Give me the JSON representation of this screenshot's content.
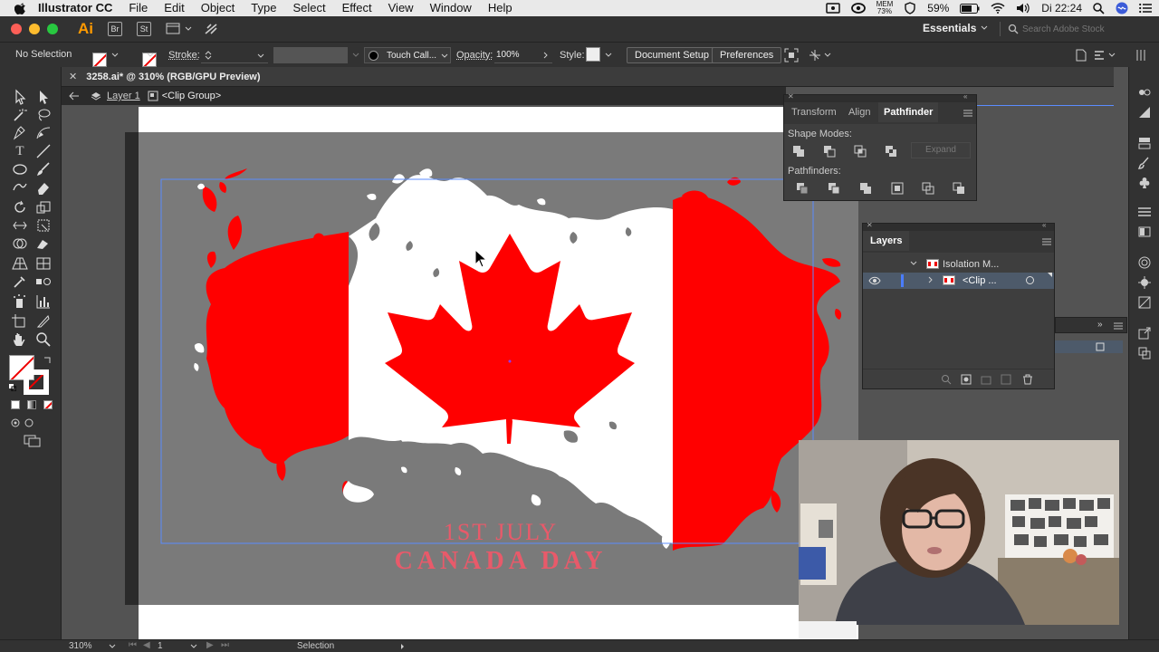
{
  "menubar": {
    "app_name": "Illustrator CC",
    "items": [
      "File",
      "Edit",
      "Object",
      "Type",
      "Select",
      "Effect",
      "View",
      "Window",
      "Help"
    ],
    "mem_label": "MEM",
    "mem_value": "73%",
    "battery": "59%",
    "clock": "Di 22:24"
  },
  "appbar": {
    "logo": "Ai",
    "bridge": "Br",
    "stock": "St",
    "workspace": "Essentials",
    "search_placeholder": "Search Adobe Stock"
  },
  "controlbar": {
    "selection": "No Selection",
    "stroke_label": "Stroke:",
    "brush": "Touch Call...",
    "opacity_label": "Opacity:",
    "opacity_value": "100%",
    "style_label": "Style:",
    "document_setup": "Document Setup",
    "preferences": "Preferences"
  },
  "document": {
    "tab_title": "3258.ai* @ 310% (RGB/GPU Preview)",
    "breadcrumb_layer": "Layer 1",
    "breadcrumb_group": "<Clip Group>"
  },
  "artwork": {
    "line1": "1ST JULY",
    "line2": "CANADA DAY",
    "colors": {
      "red": "#ff0000",
      "white": "#ffffff",
      "gray": "#7a7a7a",
      "pink": "#e85a6a"
    }
  },
  "pathfinder": {
    "tabs": [
      "Transform",
      "Align",
      "Pathfinder"
    ],
    "active_tab": "Pathfinder",
    "shape_modes_label": "Shape Modes:",
    "expand_label": "Expand",
    "pathfinders_label": "Pathfinders:"
  },
  "layers": {
    "title": "Layers",
    "rows": [
      {
        "label": "Isolation M..."
      },
      {
        "label": "<Clip ..."
      }
    ]
  },
  "statusbar": {
    "zoom": "310%",
    "artboard": "1",
    "tool": "Selection"
  }
}
